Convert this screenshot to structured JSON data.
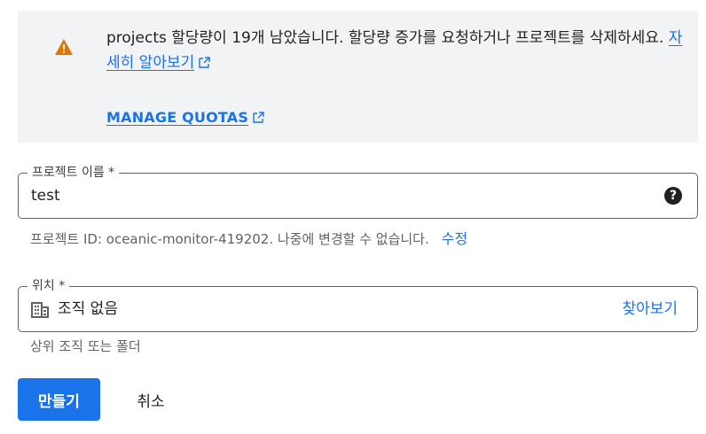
{
  "banner": {
    "icon": "warning-icon",
    "message": "projects 할당량이 19개 남았습니다. 할당량 증가를 요청하거나 프로젝트를 삭제하세요.",
    "learn_more": "자세히 알아보기",
    "manage_quotas": "MANAGE QUOTAS"
  },
  "project_name": {
    "label": "프로젝트 이름 *",
    "value": "test",
    "help_icon": "help-icon"
  },
  "project_id_hint": {
    "text": "프로젝트 ID: oceanic-monitor-419202. 나중에 변경할 수 없습니다.",
    "edit": "수정"
  },
  "location": {
    "label": "위치 *",
    "icon": "organization-icon",
    "value": "조직 없음",
    "browse": "찾아보기",
    "hint": "상위 조직 또는 폴더"
  },
  "actions": {
    "create": "만들기",
    "cancel": "취소"
  },
  "colors": {
    "accent": "#1a73e8",
    "warning": "#e37400",
    "banner_bg": "#f1f3f4"
  }
}
